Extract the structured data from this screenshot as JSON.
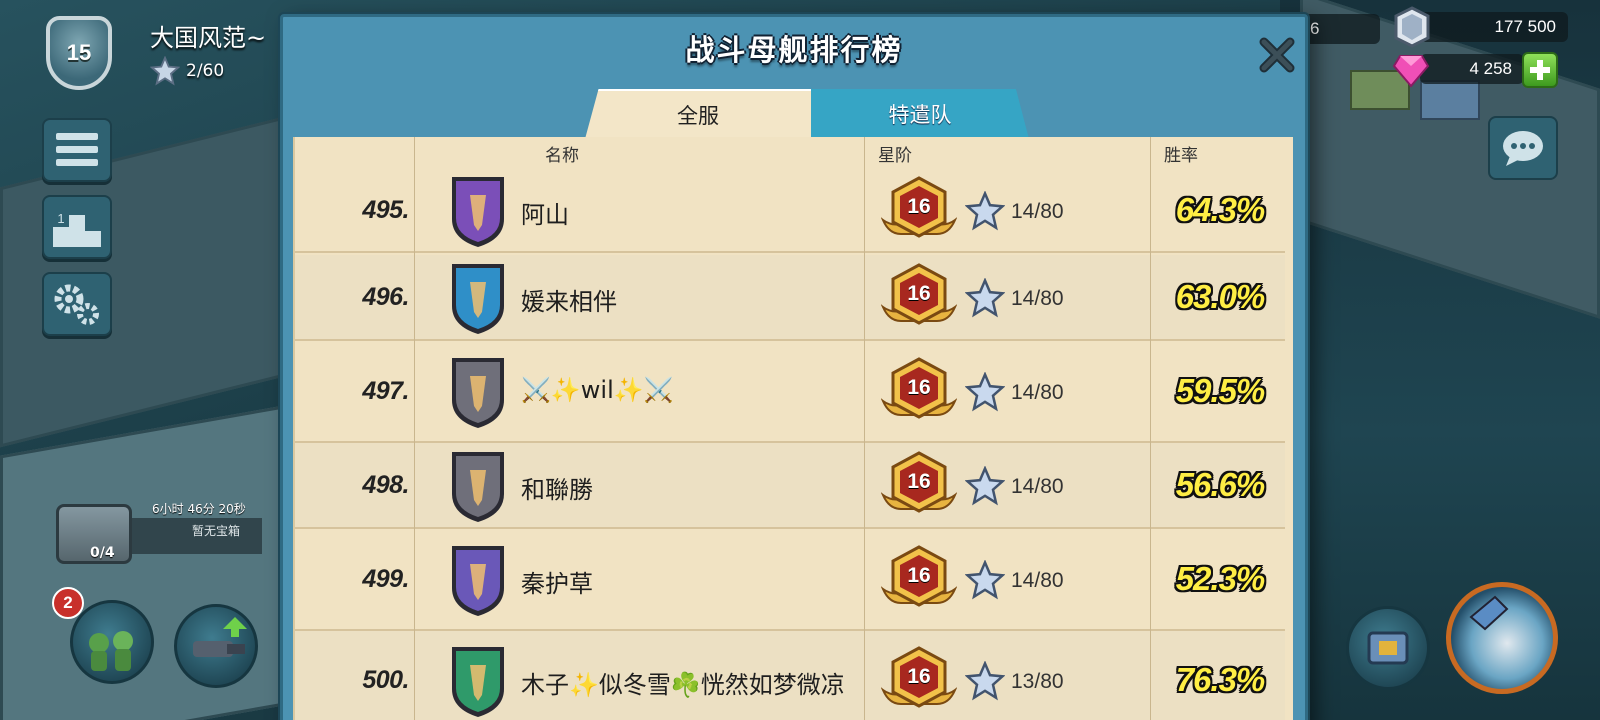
{
  "player": {
    "name": "大国风范~",
    "level": "15",
    "stars": "2/60"
  },
  "resources": {
    "partial_value": "6",
    "iron": "177 500",
    "gems": "4 258"
  },
  "chest": {
    "timer": "6小时 46分 20秒",
    "label": "暂无宝箱",
    "count": "0/4"
  },
  "troops_badge": "2",
  "leaderboard": {
    "title": "战斗母舰排行榜",
    "tabs": [
      {
        "label": "全服",
        "active": true
      },
      {
        "label": "特遣队",
        "active": false
      }
    ],
    "columns": {
      "name": "名称",
      "tier": "星阶",
      "winrate": "胜率"
    },
    "rows": [
      {
        "rank": "495.",
        "name": "阿山",
        "tier": "16",
        "stars": "14/80",
        "winrate": "64.3%",
        "emblem": "wolf-purple-emblem-icon",
        "emblem_color": "#7b4fb8"
      },
      {
        "rank": "496.",
        "name": "媛来相伴",
        "tier": "16",
        "stars": "14/80",
        "winrate": "63.0%",
        "emblem": "sword-blue-emblem-icon",
        "emblem_color": "#2f8fc8"
      },
      {
        "rank": "497.",
        "name": "⚔️✨wil✨⚔️",
        "tier": "16",
        "stars": "14/80",
        "winrate": "59.5%",
        "emblem": "seahorse-gray-emblem-icon",
        "emblem_color": "#6f6f7a"
      },
      {
        "rank": "498.",
        "name": "和聯勝",
        "tier": "16",
        "stars": "14/80",
        "winrate": "56.6%",
        "emblem": "seahorse-gray-emblem-icon",
        "emblem_color": "#6f6f7a"
      },
      {
        "rank": "499.",
        "name": "秦护草",
        "tier": "16",
        "stars": "14/80",
        "winrate": "52.3%",
        "emblem": "fist-purple-emblem-icon",
        "emblem_color": "#6a58b8"
      },
      {
        "rank": "500.",
        "name": "木子✨似冬雪☘️恍然如梦微凉",
        "tier": "16",
        "stars": "13/80",
        "winrate": "76.3%",
        "emblem": "chevron-green-emblem-icon",
        "emblem_color": "#2f9a6a"
      }
    ]
  },
  "colors": {
    "panel": "#4c93b3",
    "paper": "#f1e3c3",
    "winrate": "#ffee44",
    "tier_badge": "#d9952a"
  }
}
